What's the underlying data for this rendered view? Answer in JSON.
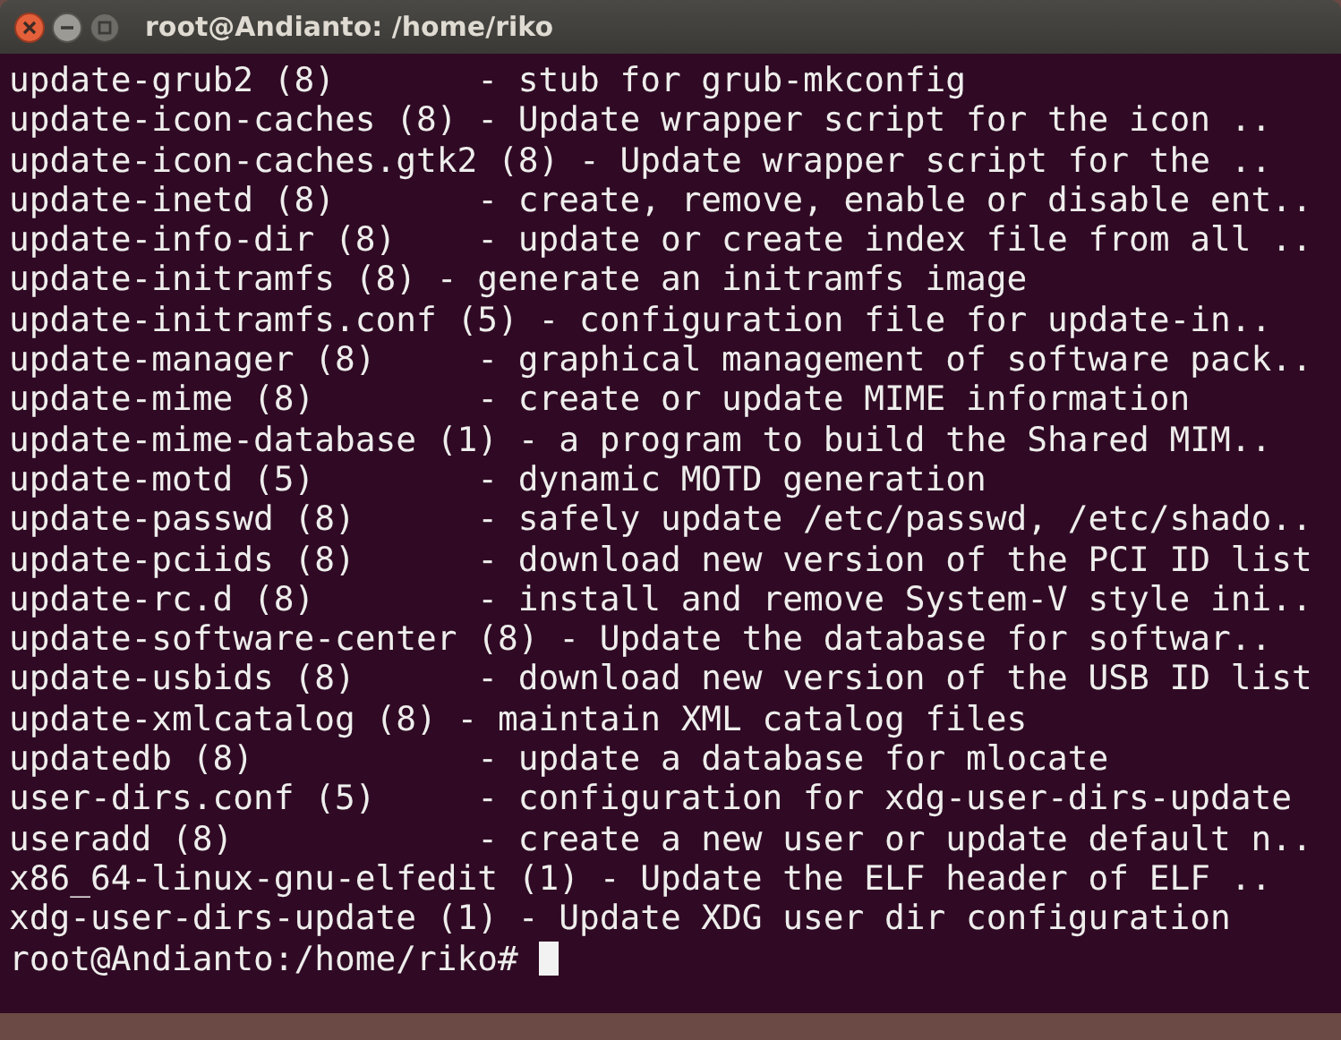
{
  "window": {
    "title": "root@Andianto: /home/riko"
  },
  "terminal": {
    "lines": [
      "update-grub2 (8)       - stub for grub-mkconfig",
      "update-icon-caches (8) - Update wrapper script for the icon ..",
      "update-icon-caches.gtk2 (8) - Update wrapper script for the ..",
      "update-inetd (8)       - create, remove, enable or disable ent..",
      "update-info-dir (8)    - update or create index file from all ..",
      "update-initramfs (8) - generate an initramfs image",
      "update-initramfs.conf (5) - configuration file for update-in..",
      "update-manager (8)     - graphical management of software pack..",
      "update-mime (8)        - create or update MIME information",
      "update-mime-database (1) - a program to build the Shared MIM..",
      "update-motd (5)        - dynamic MOTD generation",
      "update-passwd (8)      - safely update /etc/passwd, /etc/shado..",
      "update-pciids (8)      - download new version of the PCI ID list",
      "update-rc.d (8)        - install and remove System-V style ini..",
      "update-software-center (8) - Update the database for softwar..",
      "update-usbids (8)      - download new version of the USB ID list",
      "update-xmlcatalog (8) - maintain XML catalog files",
      "updatedb (8)           - update a database for mlocate",
      "user-dirs.conf (5)     - configuration for xdg-user-dirs-update",
      "useradd (8)            - create a new user or update default n..",
      "x86_64-linux-gnu-elfedit (1) - Update the ELF header of ELF ..",
      "xdg-user-dirs-update (1) - Update XDG user dir configuration"
    ],
    "prompt": "root@Andianto:/home/riko#"
  }
}
